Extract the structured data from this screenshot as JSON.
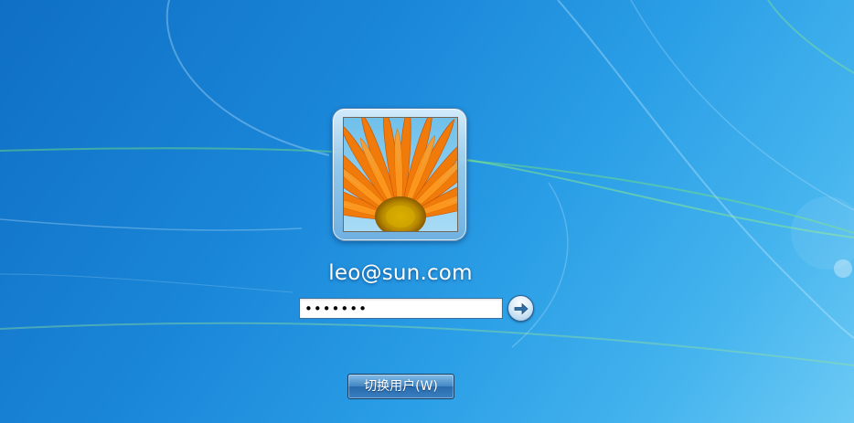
{
  "login": {
    "username": "leo@sun.com",
    "password_value": "•••••••",
    "go_button_icon": "arrow-right-icon",
    "avatar_icon": "flower-avatar-image",
    "switch_user_label": "切换用户(W)"
  },
  "colors": {
    "background_start": "#0f6fc4",
    "background_end": "#6ccaf4",
    "button_border": "#173f66",
    "field_border": "#3c6e9e",
    "flower_petal": "#f08a10",
    "flower_center": "#c9a000"
  }
}
